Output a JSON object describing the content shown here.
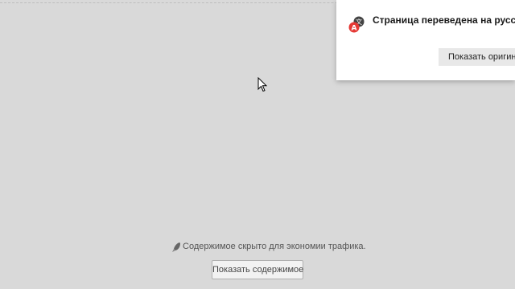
{
  "translation_popup": {
    "title": "Страница переведена на русский",
    "show_original_label": "Показать оригинал",
    "icon": "translate-icon",
    "icon_badge_letter": "A"
  },
  "hidden_content": {
    "notice": "Содержимое скрыто для экономии трафика.",
    "icon": "rocket-icon",
    "show_button_label": "Показать содержимое"
  },
  "colors": {
    "background": "#d9d9d9",
    "popup_bg": "#ffffff",
    "translate_badge": "#e53935"
  }
}
